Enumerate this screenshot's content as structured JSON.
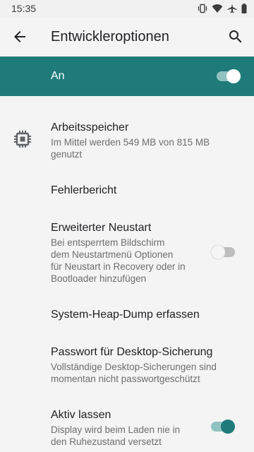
{
  "status": {
    "time": "15:35",
    "icons": [
      "vibrate-icon",
      "wifi-icon",
      "airplane-icon",
      "battery-icon"
    ]
  },
  "appbar": {
    "title": "Entwickleroptionen",
    "back_icon": "arrow-back-icon",
    "search_icon": "search-icon"
  },
  "master": {
    "label": "An",
    "enabled": true
  },
  "items": [
    {
      "title": "Arbeitsspeicher",
      "summary_line1": "Im Mittel werden 549 MB von 815 MB",
      "summary_line2": "genutzt",
      "icon": "memory-chip-icon"
    },
    {
      "title": "Fehlerbericht"
    },
    {
      "title": "Erweiterter Neustart",
      "summary_line1": "Bei entsperrtem Bildschirm",
      "summary_line2": "dem Neustartmenü Optionen",
      "summary_line3": "für Neustart in Recovery oder in",
      "summary_line4": "Bootloader hinzufügen",
      "enabled": false
    },
    {
      "title": "System-Heap-Dump erfassen"
    },
    {
      "title": "Passwort für Desktop-Sicherung",
      "summary_line1": "Vollständige Desktop-Sicherungen sind",
      "summary_line2": "momentan nicht passwortgeschützt"
    },
    {
      "title": "Aktiv lassen",
      "summary_line1": "Display wird beim Laden nie in",
      "summary_line2": "den Ruhezustand versetzt",
      "enabled": true
    }
  ],
  "colors": {
    "accent": "#1e7b7a",
    "background": "#f4f4f4"
  }
}
